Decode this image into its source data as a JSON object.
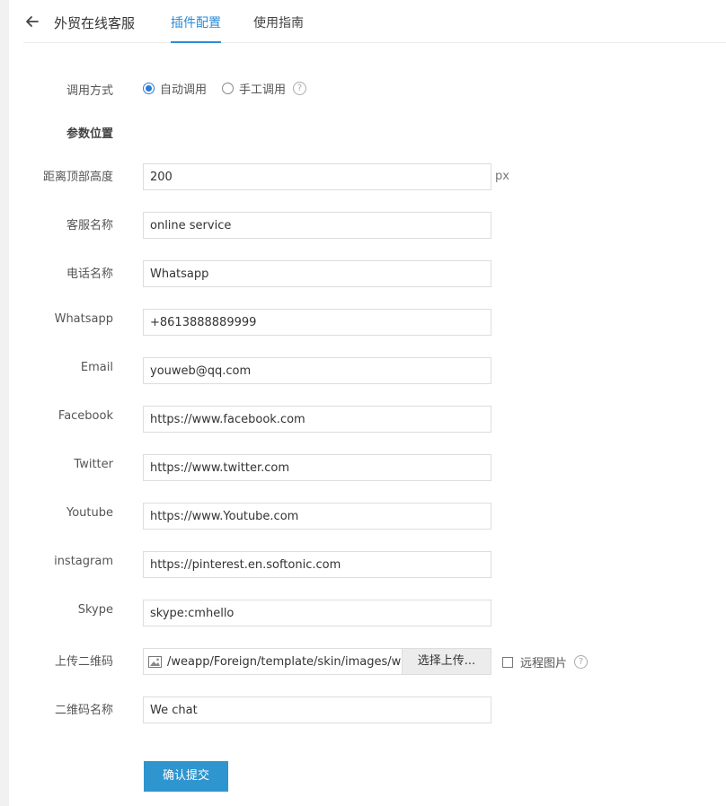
{
  "header": {
    "title": "外贸在线客服",
    "tabs": [
      "插件配置",
      "使用指南"
    ]
  },
  "call_mode": {
    "label": "调用方式",
    "options": [
      "自动调用",
      "手工调用"
    ],
    "selected": "自动调用"
  },
  "section_title": "参数位置",
  "fields": {
    "top_distance": {
      "label": "距离顶部高度",
      "value": "200",
      "unit": "px"
    },
    "service_name": {
      "label": "客服名称",
      "value": "online service"
    },
    "phone_name": {
      "label": "电话名称",
      "value": "Whatsapp"
    },
    "whatsapp": {
      "label": "Whatsapp",
      "value": "+8613888889999"
    },
    "email": {
      "label": "Email",
      "value": "youweb@qq.com"
    },
    "facebook": {
      "label": "Facebook",
      "value": "https://www.facebook.com"
    },
    "twitter": {
      "label": "Twitter",
      "value": "https://www.twitter.com"
    },
    "youtube": {
      "label": "Youtube",
      "value": "https://www.Youtube.com"
    },
    "instagram": {
      "label": "instagram",
      "value": "https://pinterest.en.softonic.com"
    },
    "skype": {
      "label": "Skype",
      "value": "skype:cmhello"
    },
    "qrcode_name": {
      "label": "二维码名称",
      "value": "We chat"
    }
  },
  "upload": {
    "label": "上传二维码",
    "path": "/weapp/Foreign/template/skin/images/wechat.png",
    "button": "选择上传...",
    "remote_label": "远程图片"
  },
  "submit_label": "确认提交",
  "colors": {
    "accent": "#2b8bd6",
    "submit": "#2e95cf"
  }
}
